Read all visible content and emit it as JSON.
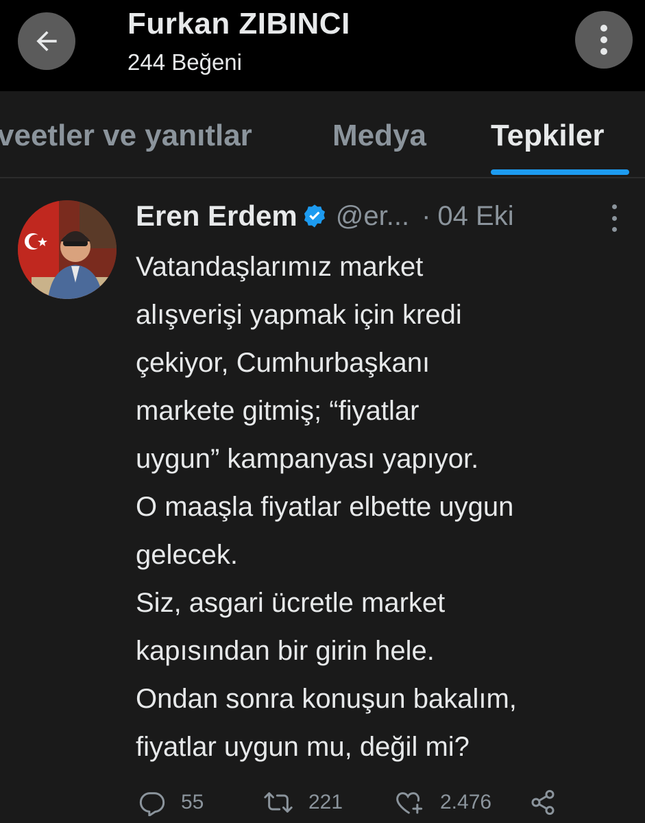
{
  "header": {
    "title": "Furkan ZIBINCI",
    "subtitle": "244 Beğeni",
    "back_icon": "arrow-left-icon",
    "menu_icon": "more-vertical-icon"
  },
  "tabs": [
    {
      "label": "veetler ve yanıtlar",
      "active": false
    },
    {
      "label": "Medya",
      "active": false
    },
    {
      "label": "Tepkiler",
      "active": true
    }
  ],
  "tweet": {
    "author_name": "Eren Erdem",
    "handle": "@er...",
    "separator": "·",
    "date": "04 Eki",
    "verified": true,
    "lines": [
      "Vatandaşlarımız market",
      "alışverişi yapmak için kredi",
      "çekiyor, Cumhurbaşkanı",
      "markete gitmiş; “fiyatlar",
      "uygun” kampanyası yapıyor.",
      "O maaşla fiyatlar elbette uygun",
      "gelecek.",
      "Siz, asgari ücretle market",
      "kapısından bir girin hele.",
      "Ondan sonra konuşun bakalım,",
      "fiyatlar uygun mu, değil mi?"
    ],
    "actions": {
      "reply_count": "55",
      "retweet_count": "221",
      "like_count": "2.476"
    }
  },
  "colors": {
    "background": "#1a1a1a",
    "header_bg": "#000000",
    "accent": "#1d9bf0",
    "muted": "#8b949c",
    "text": "#e7e9ea"
  }
}
